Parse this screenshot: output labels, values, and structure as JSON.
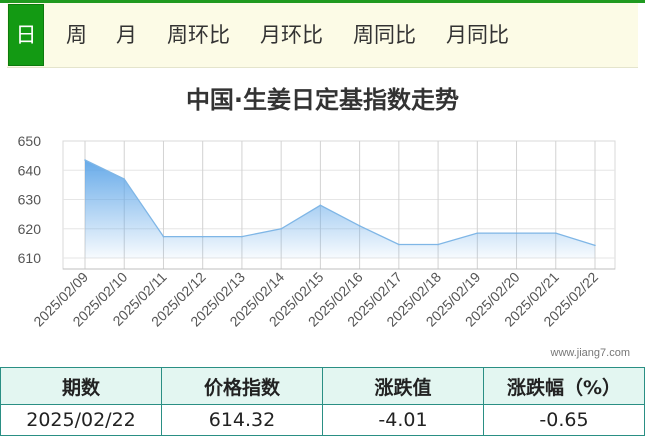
{
  "tabs": [
    {
      "label": "日",
      "active": true
    },
    {
      "label": "周",
      "active": false
    },
    {
      "label": "月",
      "active": false
    },
    {
      "label": "周环比",
      "active": false
    },
    {
      "label": "月环比",
      "active": false
    },
    {
      "label": "周同比",
      "active": false
    },
    {
      "label": "月同比",
      "active": false
    }
  ],
  "colors": {
    "accent": "#139a13",
    "line": "#7fb6e6",
    "table_border": "#2a8f84",
    "table_header_bg": "#e3f6f1"
  },
  "chart_data": {
    "type": "area",
    "title": "中国·生姜日定基指数走势",
    "x": [
      "2025/02/09",
      "2025/02/10",
      "2025/02/11",
      "2025/02/12",
      "2025/02/13",
      "2025/02/14",
      "2025/02/15",
      "2025/02/16",
      "2025/02/17",
      "2025/02/18",
      "2025/02/19",
      "2025/02/20",
      "2025/02/21",
      "2025/02/22"
    ],
    "values": [
      643.5,
      637.0,
      617.3,
      617.3,
      617.3,
      620.0,
      628.0,
      621.0,
      614.6,
      614.6,
      618.5,
      618.5,
      618.5,
      614.32
    ],
    "ylim": [
      610,
      650
    ],
    "yticks": [
      610,
      620,
      630,
      640,
      650
    ],
    "xlabel": "",
    "ylabel": "",
    "grid": true,
    "watermark": "www.jiang7.com"
  },
  "summary": {
    "headers": [
      "期数",
      "价格指数",
      "涨跌值",
      "涨跌幅（%）"
    ],
    "row": [
      "2025/02/22",
      "614.32",
      "-4.01",
      "-0.65"
    ]
  }
}
